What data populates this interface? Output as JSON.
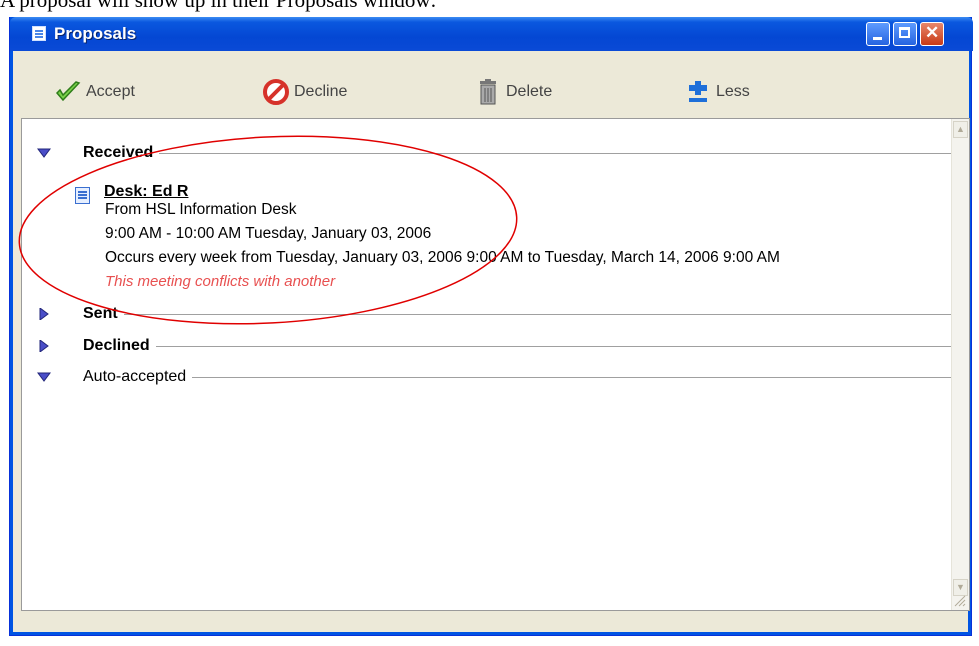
{
  "document_heading": "A proposal will show up in their Proposals window:",
  "window": {
    "title": "Proposals"
  },
  "toolbar": {
    "accept": "Accept",
    "decline": "Decline",
    "delete": "Delete",
    "less": "Less"
  },
  "sections": {
    "received": "Received",
    "sent": "Sent",
    "declined": "Declined",
    "auto_accepted": "Auto-accepted"
  },
  "proposal": {
    "title": "Desk: Ed R",
    "from": "From HSL Information Desk",
    "time": "9:00 AM - 10:00 AM  Tuesday, January 03, 2006",
    "recurrence": "Occurs every week from Tuesday, January 03, 2006 9:00 AM to Tuesday, March 14, 2006 9:00 AM",
    "conflict": "This meeting conflicts with another"
  },
  "colors": {
    "titlebar": "#0447d3",
    "conflict_text": "#e85050",
    "annotation": "#e00000"
  }
}
